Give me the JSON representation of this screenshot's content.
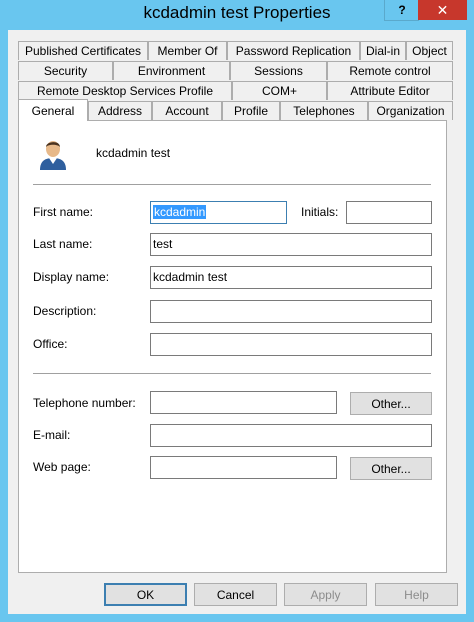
{
  "window": {
    "title": "kcdadmin test Properties",
    "help_glyph": "?",
    "close_glyph": "✕"
  },
  "tabs_row1": [
    "Published Certificates",
    "Member Of",
    "Password Replication",
    "Dial-in",
    "Object"
  ],
  "tabs_row2": [
    "Security",
    "Environment",
    "Sessions",
    "Remote control"
  ],
  "tabs_row3": [
    "Remote Desktop Services Profile",
    "COM+",
    "Attribute Editor"
  ],
  "tabs_row4": [
    "General",
    "Address",
    "Account",
    "Profile",
    "Telephones",
    "Organization"
  ],
  "general": {
    "display_header": "kcdadmin test",
    "first_name_label": "First name:",
    "first_name_value": "kcdadmin",
    "initials_label": "Initials:",
    "initials_value": "",
    "last_name_label": "Last name:",
    "last_name_value": "test",
    "display_name_label": "Display name:",
    "display_name_value": "kcdadmin test",
    "description_label": "Description:",
    "description_value": "",
    "office_label": "Office:",
    "office_value": "",
    "telephone_label": "Telephone number:",
    "telephone_value": "",
    "email_label": "E-mail:",
    "email_value": "",
    "webpage_label": "Web page:",
    "webpage_value": "",
    "other_label": "Other..."
  },
  "footer": {
    "ok": "OK",
    "cancel": "Cancel",
    "apply": "Apply",
    "help": "Help"
  }
}
